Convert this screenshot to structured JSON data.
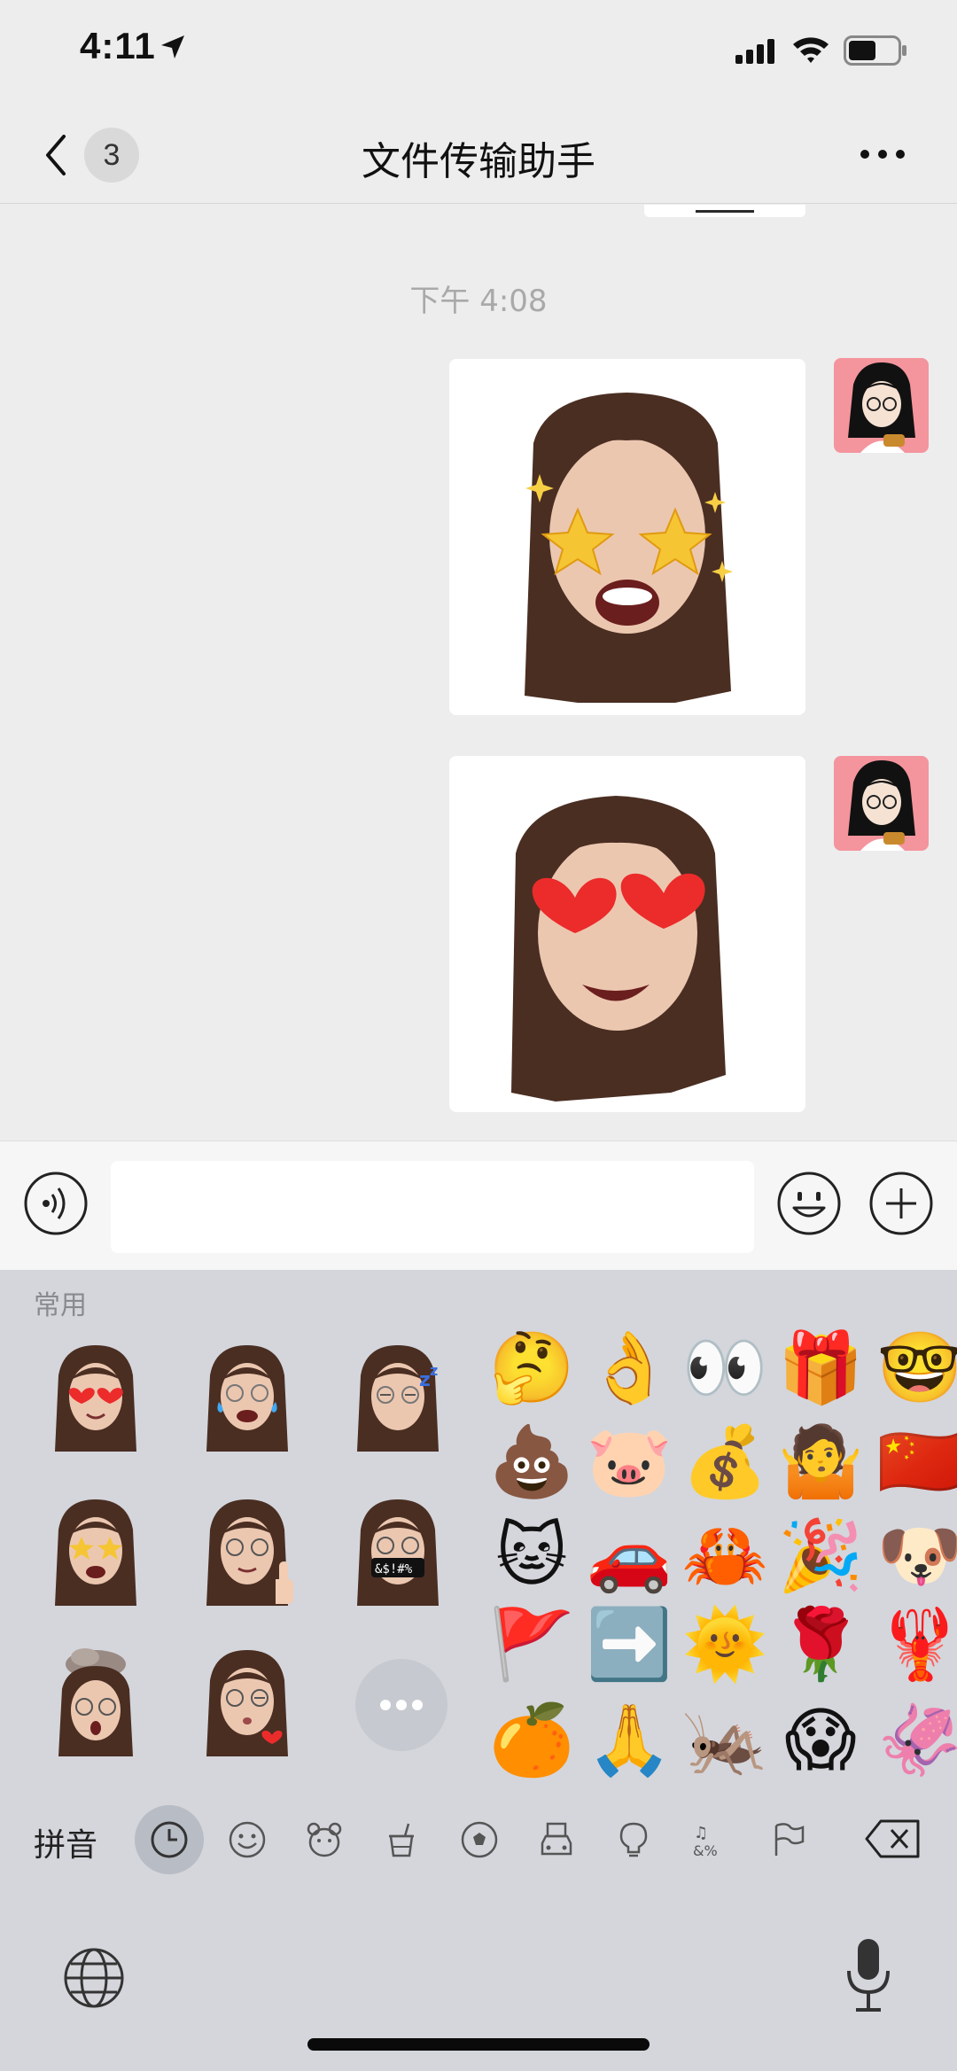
{
  "status_bar": {
    "time": "4:11"
  },
  "nav": {
    "unread_count": "3",
    "title": "文件传输助手"
  },
  "chat": {
    "timestamp": "下午 4:08",
    "messages": [
      {
        "type": "sticker",
        "sticker": "memoji-star-eyes"
      },
      {
        "type": "sticker",
        "sticker": "memoji-heart-eyes"
      }
    ]
  },
  "input": {
    "value": "",
    "placeholder": ""
  },
  "keyboard": {
    "section_label": "常用",
    "memoji_stickers": [
      "heart-eyes",
      "tears-of-joy",
      "sleeping",
      "star-struck",
      "thumbs-up",
      "cursing",
      "mind-blown",
      "kissing-heart"
    ],
    "emoji_rows": [
      [
        "🤔",
        "👌",
        "👀",
        "🎁",
        "🤓"
      ],
      [
        "💩",
        "🐷",
        "💰",
        "🤷",
        "🇨🇳"
      ],
      [
        "🐱",
        "🚗",
        "🦀",
        "🎉",
        "🐶"
      ],
      [
        "🚩",
        "➡️",
        "🌞",
        "🌹",
        "🦞"
      ],
      [
        "🍊",
        "🙏",
        "🦗",
        "😱",
        "🦑"
      ]
    ],
    "mode_label": "拼音",
    "categories": [
      "recent-icon",
      "smiley-icon",
      "animal-icon",
      "food-icon",
      "ball-icon",
      "travel-icon",
      "object-icon",
      "symbol-icon",
      "flag-icon"
    ]
  },
  "colors": {
    "avatar_bg": "#f4949d",
    "keyboard_bg": "#d4d6dc",
    "chat_bg": "#ededed"
  }
}
